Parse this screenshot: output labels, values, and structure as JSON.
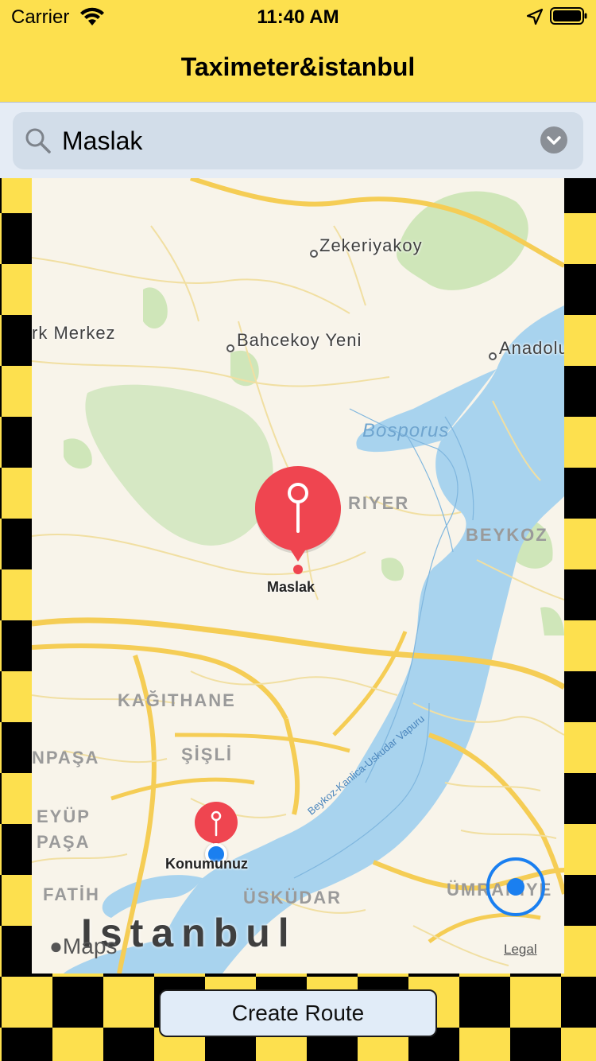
{
  "status_bar": {
    "carrier": "Carrier",
    "time": "11:40 AM",
    "icons": [
      "wifi-icon",
      "location-arrow-icon",
      "battery-icon"
    ]
  },
  "nav": {
    "title": "Taximeter&istanbul"
  },
  "search": {
    "value": "Maslak",
    "icon": "search-icon",
    "accessory": "chevron-down-icon"
  },
  "map": {
    "places": {
      "zekeriyakoy": "Zekeriyakoy",
      "kent_merkez": "rk Merkez",
      "bahcekoy": "Bahcekoy Yeni",
      "anadolu": "Anadolu"
    },
    "water": {
      "bosporus": "Bosporus"
    },
    "districts": {
      "sariyer": "RIYER",
      "beykoz": "BEYKOZ",
      "kagithane": "KAĞITHANE",
      "sisli": "ŞİŞLİ",
      "gaziosmanpasa": "NPAŞA",
      "eyup_1": "EYÜP",
      "eyup_2": "PAŞA",
      "fatih": "FATİH",
      "uskudar": "ÜSKÜDAR",
      "umraniye": "ÜMRANİYE"
    },
    "city": "Istanbul",
    "ferry": "Beykoz-Kanlica-Uskudar Vapuru",
    "pins": {
      "destination_label": "Maslak",
      "current_label": "Konumunuz"
    },
    "attribution": {
      "logo": "Maps",
      "legal": "Legal"
    }
  },
  "actions": {
    "create_route": "Create Route"
  },
  "colors": {
    "bar_yellow": "#fde04e",
    "checker_yellow": "#fde04e",
    "checker_black": "#000000",
    "pin_red": "#ef4550",
    "user_blue": "#1a7ff0",
    "water": "#a8d3ee",
    "park": "#cfe6b9"
  }
}
